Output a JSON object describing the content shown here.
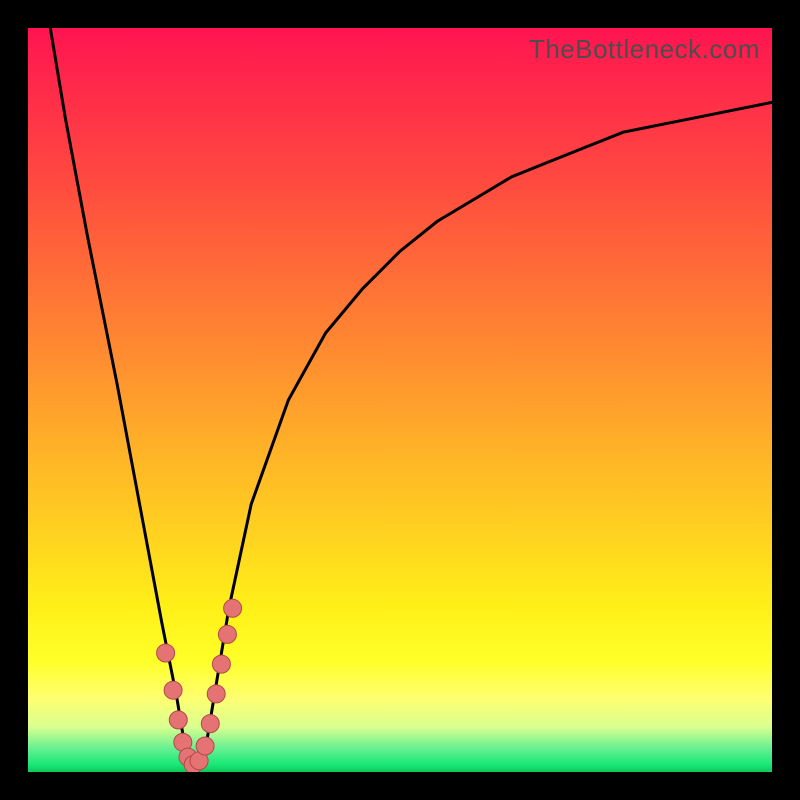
{
  "watermark": "TheBottleneck.com",
  "colors": {
    "frame": "#000000",
    "curve": "#000000",
    "marker_fill": "#e57373",
    "marker_stroke": "#b04a4a",
    "gradient_top": "#ff1450",
    "gradient_bottom": "#10c858"
  },
  "chart_data": {
    "type": "line",
    "title": "",
    "xlabel": "",
    "ylabel": "",
    "x_range": [
      0,
      100
    ],
    "y_range": [
      0,
      100
    ],
    "description": "Bottleneck curve: y-axis is bottleneck percentage (0 at bottom, 100 at top). A deep V with minimum near x≈22 where bottleneck≈0. Left branch rises steeply toward 100; right branch rises with diminishing slope approaching ~90.",
    "series": [
      {
        "name": "bottleneck-curve",
        "x": [
          3,
          5,
          8,
          12,
          15,
          18,
          20,
          21,
          22,
          23,
          24,
          25,
          27,
          30,
          35,
          40,
          45,
          50,
          55,
          60,
          65,
          70,
          75,
          80,
          85,
          90,
          95,
          100
        ],
        "y": [
          100,
          88,
          72,
          52,
          36,
          20,
          10,
          4,
          1,
          1,
          4,
          10,
          22,
          36,
          50,
          59,
          65,
          70,
          74,
          77,
          80,
          82,
          84,
          86,
          87,
          88,
          89,
          90
        ]
      }
    ],
    "markers": {
      "name": "highlighted-points",
      "x": [
        18.5,
        19.5,
        20.2,
        20.8,
        21.5,
        22.2,
        23.0,
        23.8,
        24.5,
        25.3,
        26.0,
        26.8,
        27.5
      ],
      "y": [
        16.0,
        11.0,
        7.0,
        4.0,
        2.0,
        1.0,
        1.5,
        3.5,
        6.5,
        10.5,
        14.5,
        18.5,
        22.0
      ]
    }
  }
}
